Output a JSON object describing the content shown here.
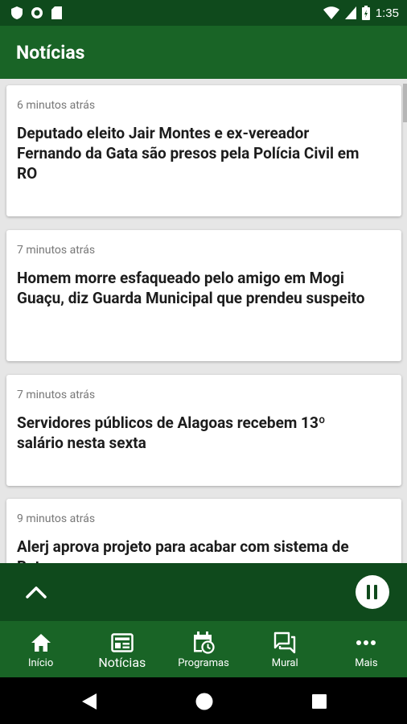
{
  "status_bar": {
    "time": "1:35",
    "icons": [
      "shield-icon",
      "circle-icon",
      "sd-card-icon",
      "wifi-icon",
      "signal-icon",
      "battery-icon"
    ]
  },
  "app_bar": {
    "title": "Notícias"
  },
  "news": [
    {
      "time": "6 minutos atrás",
      "title": "Deputado eleito Jair Montes e ex-vereador Fernando da Gata são presos pela Polícia Civil em RO"
    },
    {
      "time": "7 minutos atrás",
      "title": "Homem morre esfaqueado pelo amigo em Mogi Guaçu, diz Guarda Municipal que prendeu suspeito"
    },
    {
      "time": "7 minutos atrás",
      "title": "Servidores públicos de Alagoas recebem 13º salário nesta sexta"
    },
    {
      "time": "9 minutos atrás",
      "title": "Alerj aprova projeto para acabar com sistema de Bets"
    }
  ],
  "player": {
    "expand_icon": "chevron-up-icon",
    "pause_icon": "pause-icon"
  },
  "bottom_nav": [
    {
      "label": "Início",
      "icon": "home-icon",
      "active": false
    },
    {
      "label": "Notícias",
      "icon": "news-icon",
      "active": true
    },
    {
      "label": "Programas",
      "icon": "calendar-clock-icon",
      "active": false
    },
    {
      "label": "Mural",
      "icon": "chat-icon",
      "active": false
    },
    {
      "label": "Mais",
      "icon": "more-icon",
      "active": false
    }
  ],
  "colors": {
    "primary": "#196426",
    "primary_dark": "#0f4a1c",
    "background": "#e6e6e6",
    "card": "#ffffff"
  }
}
